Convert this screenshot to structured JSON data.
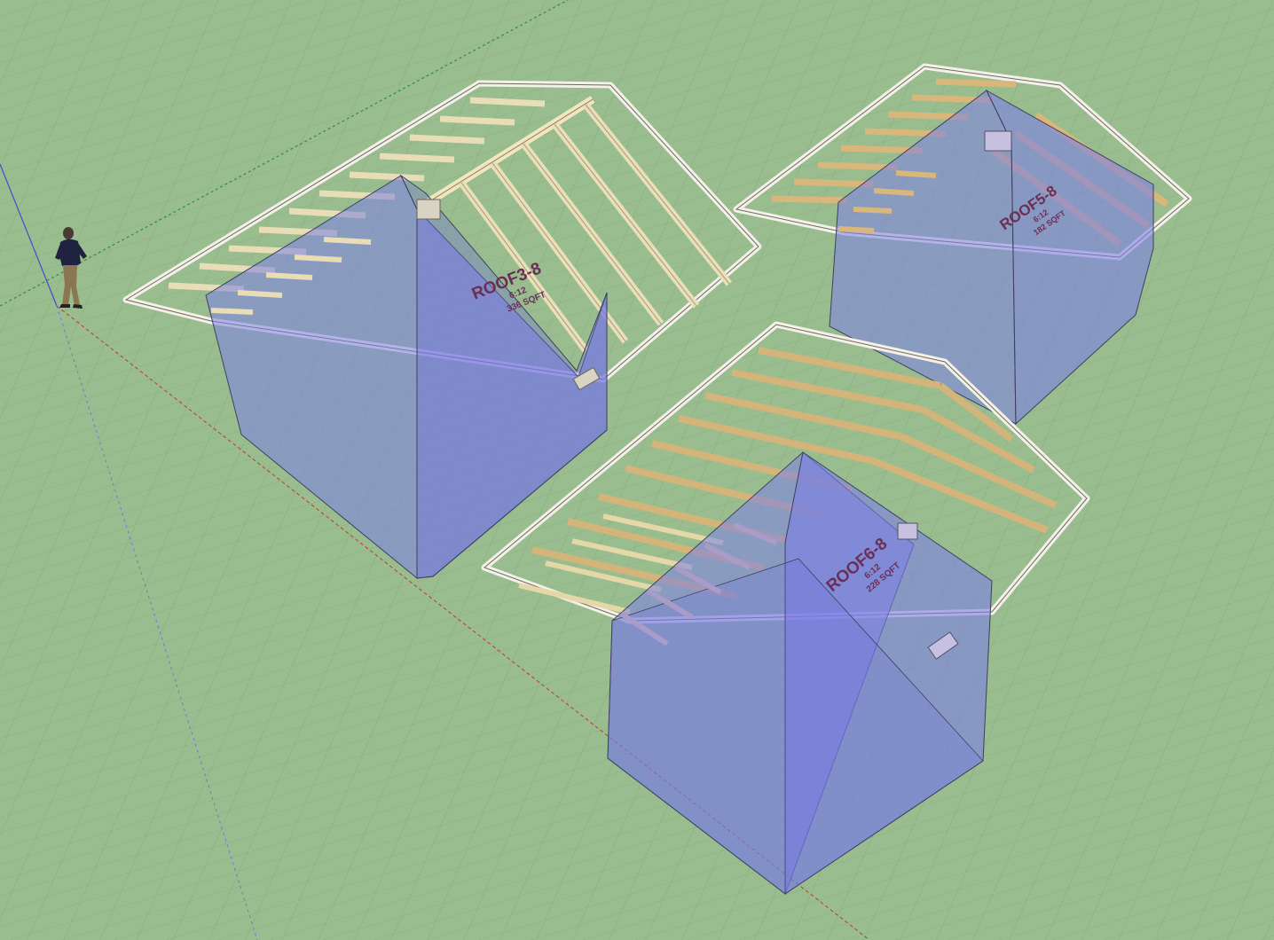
{
  "scene": {
    "background_color": "#99bd8e",
    "grid_color": "#86a97c",
    "red_axis_color": "#c0392b",
    "green_axis_color": "#2f8f3a",
    "blue_axis_color": "#3b4fd6",
    "wall_fill": "#7c7fe6",
    "lumber_light": "#efe6c4",
    "lumber_mid": "#d8c489",
    "lumber_dark": "#b18d56",
    "person_icon": "scale-figure-icon"
  },
  "roofs": [
    {
      "name": "ROOF3-8",
      "pitch": "6:12",
      "area": "336 SQFT"
    },
    {
      "name": "ROOF5-8",
      "pitch": "6:12",
      "area": "182 SQFT"
    },
    {
      "name": "ROOF6-8",
      "pitch": "6:12",
      "area": "228 SQFT"
    }
  ]
}
